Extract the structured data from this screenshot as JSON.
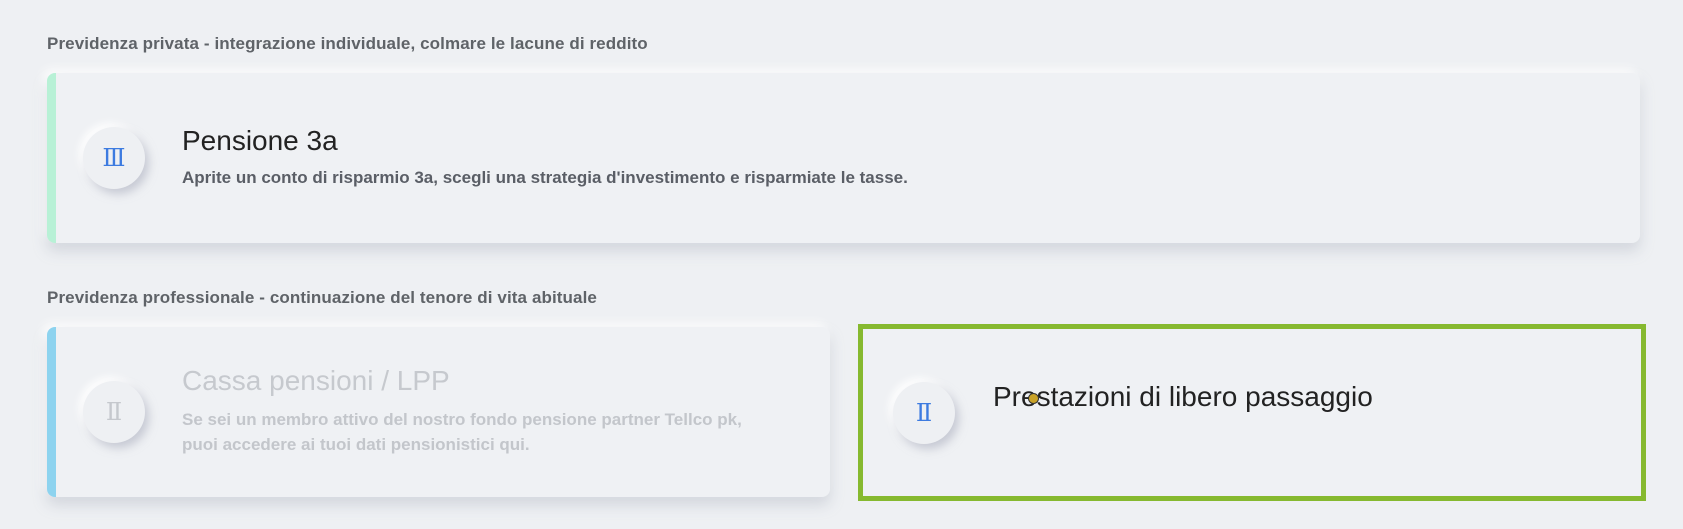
{
  "sections": {
    "private_title": "Previdenza privata - integrazione individuale, colmare le lacune di reddito",
    "professional_title": "Previdenza professionale - continuazione del tenore di vita abituale"
  },
  "cards": {
    "pillar3a": {
      "icon": "Ⅲ",
      "title": "Pensione 3a",
      "description": "Aprite un conto di risparmio 3a, scegli una strategia d'investimento e risparmiate le tasse.",
      "accent_color": "#b8f1d6"
    },
    "pension_fund": {
      "icon": "Ⅱ",
      "title": "Cassa pensioni / LPP",
      "description": "Se sei un membro attivo del nostro fondo pensione partner Tellco pk, puoi accedere ai tuoi dati pensionistici qui.",
      "accent_color": "#8dd3ef",
      "state": "disabled"
    },
    "vested_benefits": {
      "icon": "Ⅱ",
      "title": "Prestazioni di libero passaggio",
      "highlight_color": "#86b92f",
      "state": "highlighted"
    }
  }
}
